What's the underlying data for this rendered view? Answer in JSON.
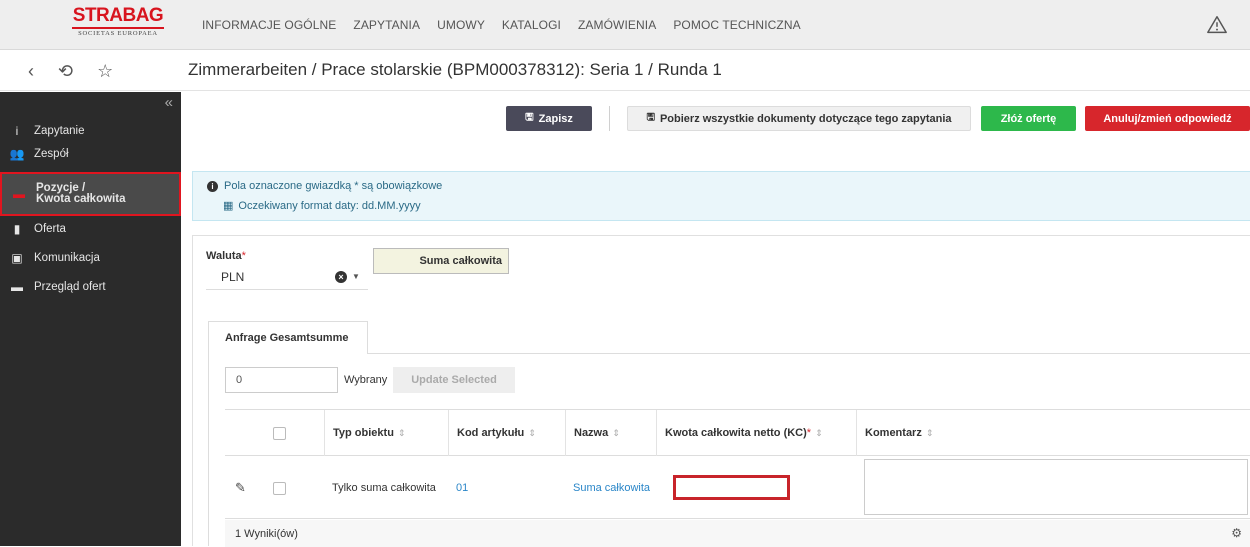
{
  "brand": {
    "name": "STRABAG",
    "tagline": "SOCIETAS EUROPAEA",
    "color": "#d8141e"
  },
  "nav": {
    "items": [
      "INFORMACJE OGÓLNE",
      "ZAPYTANIA",
      "UMOWY",
      "KATALOGI",
      "ZAMÓWIENIA",
      "POMOC TECHNICZNA"
    ],
    "warning_icon": "warning-triangle-icon"
  },
  "subbar": {
    "icons": [
      "chevron-left-icon",
      "history-icon",
      "star-icon"
    ],
    "title": "Zimmerarbeiten / Prace stolarskie (BPM000378312): Seria 1 / Runda 1"
  },
  "sidebar": {
    "collapse_icon": "double-chevron-left-icon",
    "items": [
      {
        "icon": "info-icon",
        "label": "Zapytanie"
      },
      {
        "icon": "team-icon",
        "label": "Zespół"
      },
      {
        "icon": "list-icon",
        "label_line1": "Pozycje /",
        "label_line2": "Kwota całkowita",
        "active": true
      },
      {
        "icon": "document-icon",
        "label": "Oferta"
      },
      {
        "icon": "chat-icon",
        "label": "Komunikacja"
      },
      {
        "icon": "archive-icon",
        "label": "Przegląd ofert"
      }
    ]
  },
  "toolbar": {
    "save_label": "Zapisz",
    "download_label": "Pobierz wszystkie dokumenty dotyczące tego zapytania",
    "submit_offer_label": "Złóż ofertę",
    "cancel_label": "Anuluj/zmień odpowiedź",
    "accent_green": "#2db84b",
    "accent_red": "#d7262c"
  },
  "info": {
    "required_note": "Pola oznaczone gwiazdką * są obowiązkowe",
    "date_format_note": "Oczekiwany format daty: dd.MM.yyyy"
  },
  "form": {
    "currency_label": "Waluta",
    "required_mark": "*",
    "currency_value": "PLN",
    "total_box_label": "Suma całkowita"
  },
  "tabs": {
    "active": "Anfrage Gesamtsumme"
  },
  "selection": {
    "count_value": "0",
    "selected_label": "Wybrany",
    "update_label": "Update Selected"
  },
  "table": {
    "columns": {
      "typ": "Typ obiektu",
      "kod": "Kod artykułu",
      "nazwa": "Nazwa",
      "kwota": "Kwota całkowita netto (KC)",
      "komentarz": "Komentarz"
    },
    "rows": [
      {
        "typ": "Tylko suma całkowita",
        "kod": "01",
        "nazwa": "Suma całkowita",
        "kwota": "",
        "komentarz": ""
      }
    ],
    "results": "1 Wyniki(ów)"
  }
}
